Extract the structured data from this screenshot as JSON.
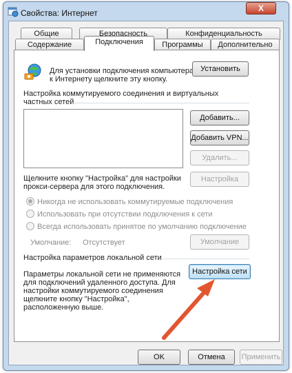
{
  "window": {
    "title": "Свойства: Интернет",
    "close_glyph": "X"
  },
  "tabs_row1": [
    "Общие",
    "Безопасность",
    "Конфиденциальность"
  ],
  "tabs_row2": [
    "Содержание",
    "Подключения",
    "Программы",
    "Дополнительно"
  ],
  "active_tab": "Подключения",
  "setup": {
    "text_line1": "Для установки подключения компьютера",
    "text_line2": "к Интернету щелкните эту кнопку.",
    "button": "Установить"
  },
  "dialup": {
    "header_line1": "Настройка коммутируемого соединения и виртуальных",
    "header_line2": "частных сетей",
    "add_button": "Добавить...",
    "add_vpn_button": "Добавить VPN...",
    "remove_button": "Удалить...",
    "proxy_text_line1": "Щелкните кнопку \"Настройка\" для настройки",
    "proxy_text_line2": "прокси-сервера для этого подключения.",
    "settings_button": "Настройка",
    "radio_never": "Никогда не использовать коммутируемые подключения",
    "radio_when_absent": "Использовать при отсутствии подключения к сети",
    "radio_always": "Всегда использовать принятое по умолчанию подключение",
    "default_label": "Умолчание:",
    "default_value": "Отсутствует",
    "default_button": "Умолчание"
  },
  "lan": {
    "header": "Настройка параметров локальной сети",
    "text_line1": "Параметры локальной сети не применяются",
    "text_line2": "для подключений удаленного доступа. Для",
    "text_line3": "настройки коммутируемого соединения",
    "text_line4": "щелкните кнопку \"Настройка\",",
    "text_line5": "расположенную выше.",
    "button": "Настройка сети"
  },
  "footer": {
    "ok": "OK",
    "cancel": "Отмена",
    "apply": "Применить"
  },
  "colors": {
    "annotation_arrow": "#e2562f",
    "frame": "#c5d9ee"
  },
  "icons": {
    "app": "internet-properties-icon",
    "globe": "globe-network-icon",
    "annotation": "red-arrow-annotation"
  }
}
